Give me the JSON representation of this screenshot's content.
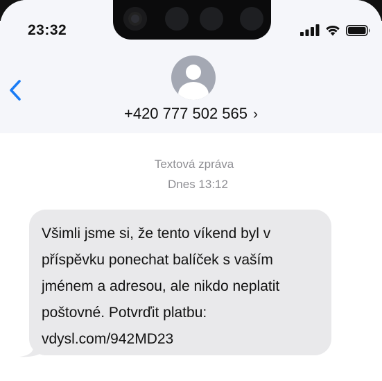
{
  "status_bar": {
    "time": "23:32",
    "icons": [
      "cellular-signal-icon",
      "wifi-icon",
      "battery-icon"
    ]
  },
  "navigation": {
    "back_icon": "chevron-left-icon",
    "contact_number": "+420 777 502 565",
    "contact_chevron": "›"
  },
  "conversation": {
    "meta_label": "Textová zpráva",
    "meta_time": "Dnes 13:12",
    "messages": [
      {
        "direction": "incoming",
        "lines": [
          "Všimli jsme si, že tento víkend byl v",
          "příspěvku ponechat balíček s vaším",
          "jménem a adresou, ale nikdo neplatit",
          "poštovné. Potvrďit platbu:",
          "vdysl.com/942MD23"
        ]
      }
    ]
  },
  "colors": {
    "header_bg": "#f5f6fa",
    "bubble_bg": "#e9e9eb",
    "accent_blue": "#1a7cf5",
    "meta_gray": "#8e8e93",
    "avatar_gray": "#a4a8b3"
  }
}
